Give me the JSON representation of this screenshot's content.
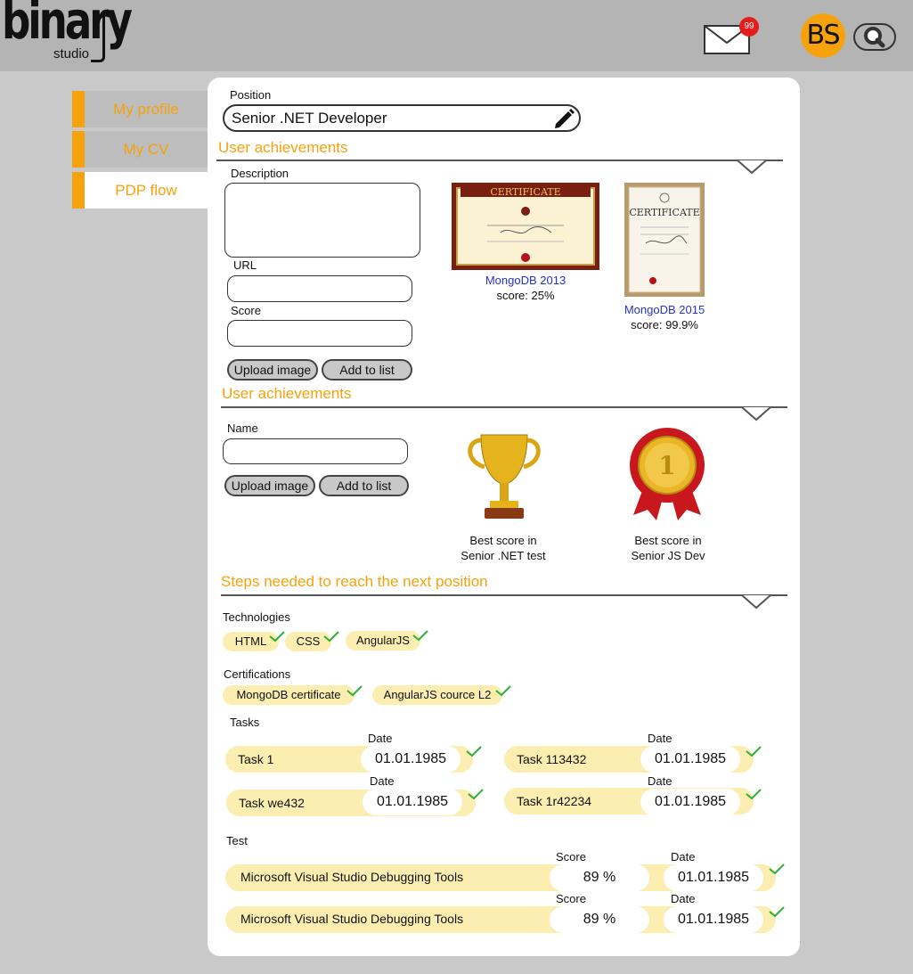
{
  "brand": {
    "name": "binary",
    "sub": "studio"
  },
  "header": {
    "mail_count": "99",
    "avatar_initials": "BS"
  },
  "sidebar": {
    "items": [
      {
        "label": "My profile"
      },
      {
        "label": "My CV"
      },
      {
        "label": "PDP flow"
      }
    ]
  },
  "position": {
    "label": "Position",
    "value": "Senior .NET Developer"
  },
  "achievements1": {
    "title": "User achievements",
    "description_label": "Description",
    "url_label": "URL",
    "score_label": "Score",
    "upload_label": "Upload image",
    "add_label": "Add to list",
    "certificates": [
      {
        "name": "MongoDB 2013",
        "score": "score: 25%",
        "image_text": "CERTIFICATE"
      },
      {
        "name": "MongoDB 2015",
        "score": "score: 99.9%",
        "image_text": "CERTIFICATE"
      }
    ]
  },
  "achievements2": {
    "title": "User achievements",
    "name_label": "Name",
    "upload_label": "Upload image",
    "add_label": "Add to list",
    "awards": [
      {
        "line1": "Best score in",
        "line2": "Senior .NET test",
        "icon": "trophy-icon"
      },
      {
        "line1": "Best score in",
        "line2": "Senior JS Dev",
        "icon": "medal-icon"
      }
    ]
  },
  "steps": {
    "title": "Steps needed to reach the next position",
    "technologies_label": "Technologies",
    "technologies": [
      "HTML",
      "CSS",
      "AngularJS"
    ],
    "certifications_label": "Certifications",
    "certifications": [
      "MongoDB certificate",
      "AngularJS cource L2"
    ],
    "tasks_label": "Tasks",
    "date_label": "Date",
    "tasks": [
      {
        "name": "Task 1",
        "date": "01.01.1985"
      },
      {
        "name": "Task 113432",
        "date": "01.01.1985"
      },
      {
        "name": "Task we432",
        "date": "01.01.1985"
      },
      {
        "name": "Task 1r42234",
        "date": "01.01.1985"
      }
    ],
    "test_label": "Test",
    "score_label": "Score",
    "tests": [
      {
        "name": "Microsoft Visual Studio Debugging Tools",
        "score": "89 %",
        "date": "01.01.1985"
      },
      {
        "name": "Microsoft Visual Studio Debugging Tools",
        "score": "89 %",
        "date": "01.01.1985"
      }
    ]
  },
  "colors": {
    "accent": "#f5a20c",
    "chip": "#fbeeb0",
    "check": "#2fae3a",
    "link": "#2233cc"
  }
}
